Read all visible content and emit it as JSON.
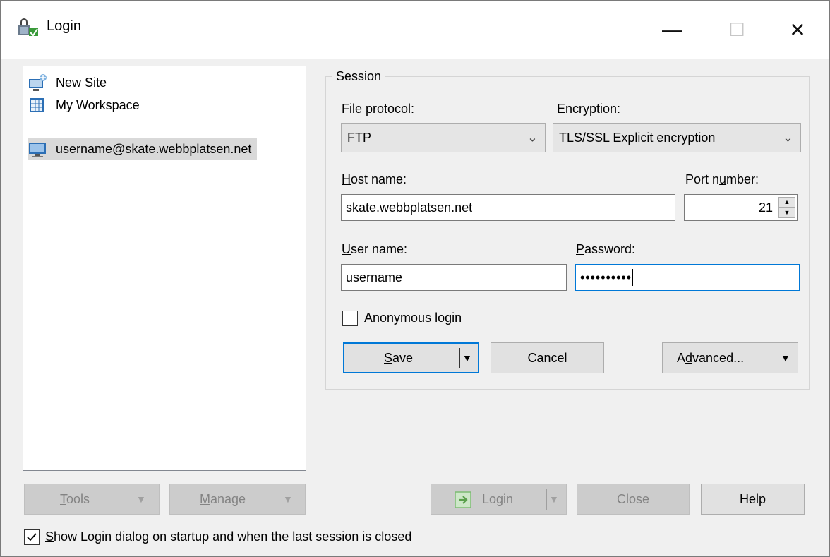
{
  "window": {
    "title": "Login",
    "minimize_glyph": "—",
    "maximize_glyph": "☐",
    "close_glyph": "✕"
  },
  "sites": [
    {
      "label": "New Site",
      "icon": "new-site-icon"
    },
    {
      "label": "My Workspace",
      "icon": "workspace-icon"
    },
    {
      "label": "username@skate.webbplatsen.net",
      "icon": "monitor-icon",
      "selected": true
    }
  ],
  "session": {
    "group_title": "Session",
    "file_protocol": {
      "label_first": "F",
      "label_rest": "ile protocol:",
      "value": "FTP"
    },
    "encryption": {
      "label_first": "E",
      "label_rest": "ncryption:",
      "value": "TLS/SSL Explicit encryption"
    },
    "host": {
      "label_first": "H",
      "label_rest": "ost name:",
      "value": "skate.webbplatsen.net"
    },
    "port": {
      "label_pre": "Port n",
      "label_ul": "u",
      "label_post": "mber:",
      "value": "21"
    },
    "user": {
      "label_first": "U",
      "label_rest": "ser name:",
      "value": "username"
    },
    "password": {
      "label_first": "P",
      "label_rest": "assword:",
      "value": "••••••••••"
    },
    "anonymous": {
      "label_first": "A",
      "label_rest": "nonymous login",
      "checked": false
    },
    "save_label_first": "S",
    "save_label_rest": "ave",
    "cancel_label": "Cancel",
    "advanced_pre": "A",
    "advanced_ul": "d",
    "advanced_post": "vanced..."
  },
  "footer": {
    "tools_first": "T",
    "tools_rest": "ools",
    "manage_first": "M",
    "manage_rest": "anage",
    "login_label": "Login",
    "close_label": "Close",
    "help_label": "Help",
    "startup_first": "S",
    "startup_rest": "how Login dialog on startup and when the last session is closed",
    "startup_checked": true
  },
  "colors": {
    "accent": "#0078d7",
    "selection": "#d9d9d9",
    "disabled_text": "#838383"
  }
}
